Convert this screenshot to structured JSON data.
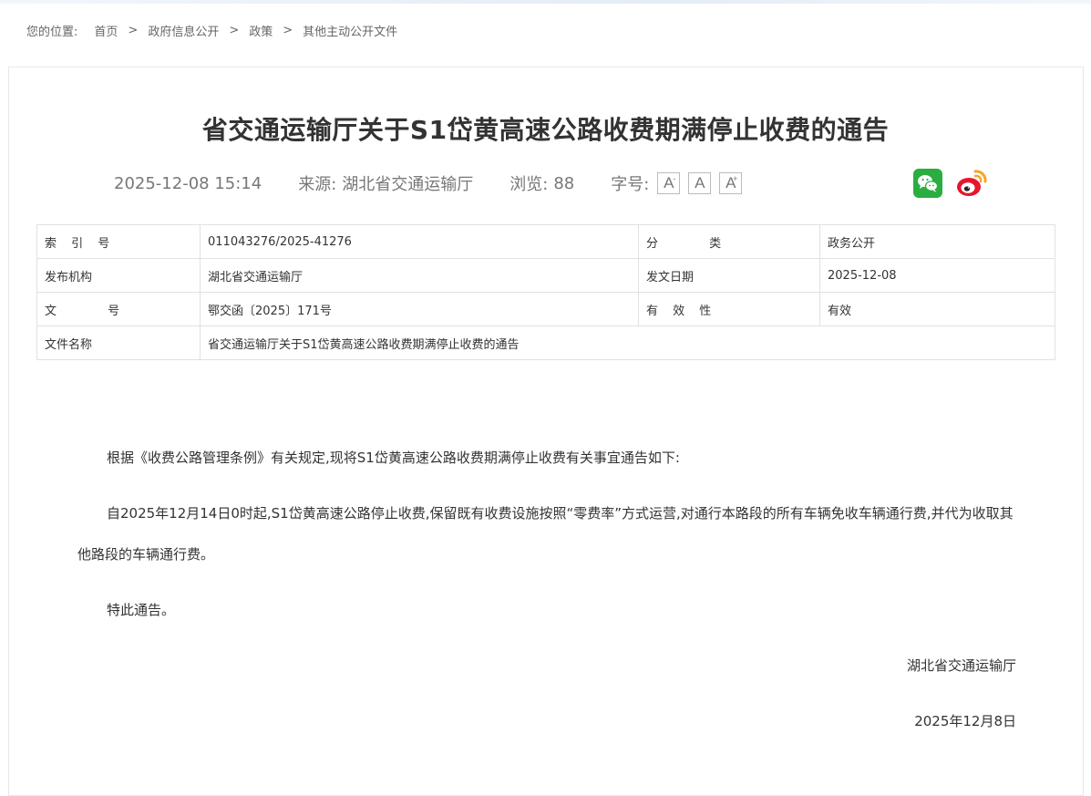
{
  "breadcrumb": {
    "prefix": "您的位置:",
    "items": [
      "首页",
      "政府信息公开",
      "政策",
      "其他主动公开文件"
    ],
    "separator": ">"
  },
  "article": {
    "title": "省交通运输厅关于S1岱黄高速公路收费期满停止收费的通告",
    "meta": {
      "datetime": "2025-12-08 15:14",
      "source_label": "来源:",
      "source": "湖北省交通运输厅",
      "views_label": "浏览:",
      "views": "88",
      "fontsize_label": "字号:",
      "fontsize_buttons": [
        "A",
        "A",
        "A"
      ]
    }
  },
  "share": {
    "wechat_icon": "wechat-icon",
    "weibo_icon": "weibo-icon",
    "colors": {
      "wechat": "#2aae3f",
      "weibo": "#e6162d",
      "weibo_accent": "#f5a623"
    }
  },
  "info_table": {
    "index_label": "索 引 号",
    "index_value": "011043276/2025-41276",
    "category_label": "分 类",
    "category_value": "政务公开",
    "publisher_label": "发布机构",
    "publisher_value": "湖北省交通运输厅",
    "date_label": "发文日期",
    "date_value": "2025-12-08",
    "doc_no_label": "文 号",
    "doc_no_value": "鄂交函〔2025〕171号",
    "validity_label": "有 效 性",
    "validity_value": "有效",
    "filename_label": "文件名称",
    "filename_value": "省交通运输厅关于S1岱黄高速公路收费期满停止收费的通告"
  },
  "content": {
    "paragraphs": [
      "根据《收费公路管理条例》有关规定,现将S1岱黄高速公路收费期满停止收费有关事宜通告如下:",
      "自2025年12月14日0时起,S1岱黄高速公路停止收费,保留既有收费设施按照“零费率”方式运营,对通行本路段的所有车辆免收车辆通行费,并代为收取其他路段的车辆通行费。",
      "特此通告。"
    ],
    "signer": "湖北省交通运输厅",
    "sign_date": "2025年12月8日"
  }
}
